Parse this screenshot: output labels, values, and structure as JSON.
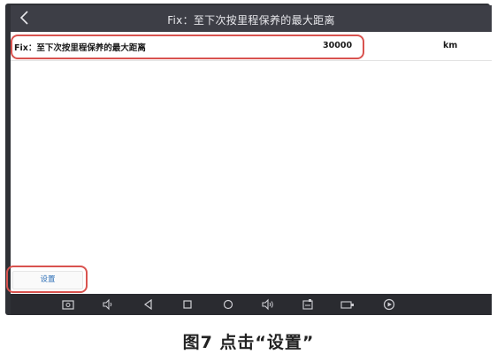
{
  "header": {
    "title": "Fix：至下次按里程保养的最大距离",
    "back_icon": "chevron-left-icon"
  },
  "row": {
    "label": "Fix：至下次按里程保养的最大距离",
    "value": "30000",
    "unit": "km"
  },
  "settings_button": {
    "label": "设置"
  },
  "navbar": {
    "icons": [
      "screenshot-icon",
      "volume-down-icon",
      "back-icon",
      "recent-apps-icon",
      "home-icon",
      "volume-up-icon",
      "diagnostic-icon",
      "vci-icon",
      "play-icon"
    ]
  },
  "caption": "图7 点击“设置”",
  "colors": {
    "highlight": "#d9534f",
    "titlebar": "#3d3e46",
    "navbar": "#2a2b30",
    "link": "#2d6fb6"
  }
}
